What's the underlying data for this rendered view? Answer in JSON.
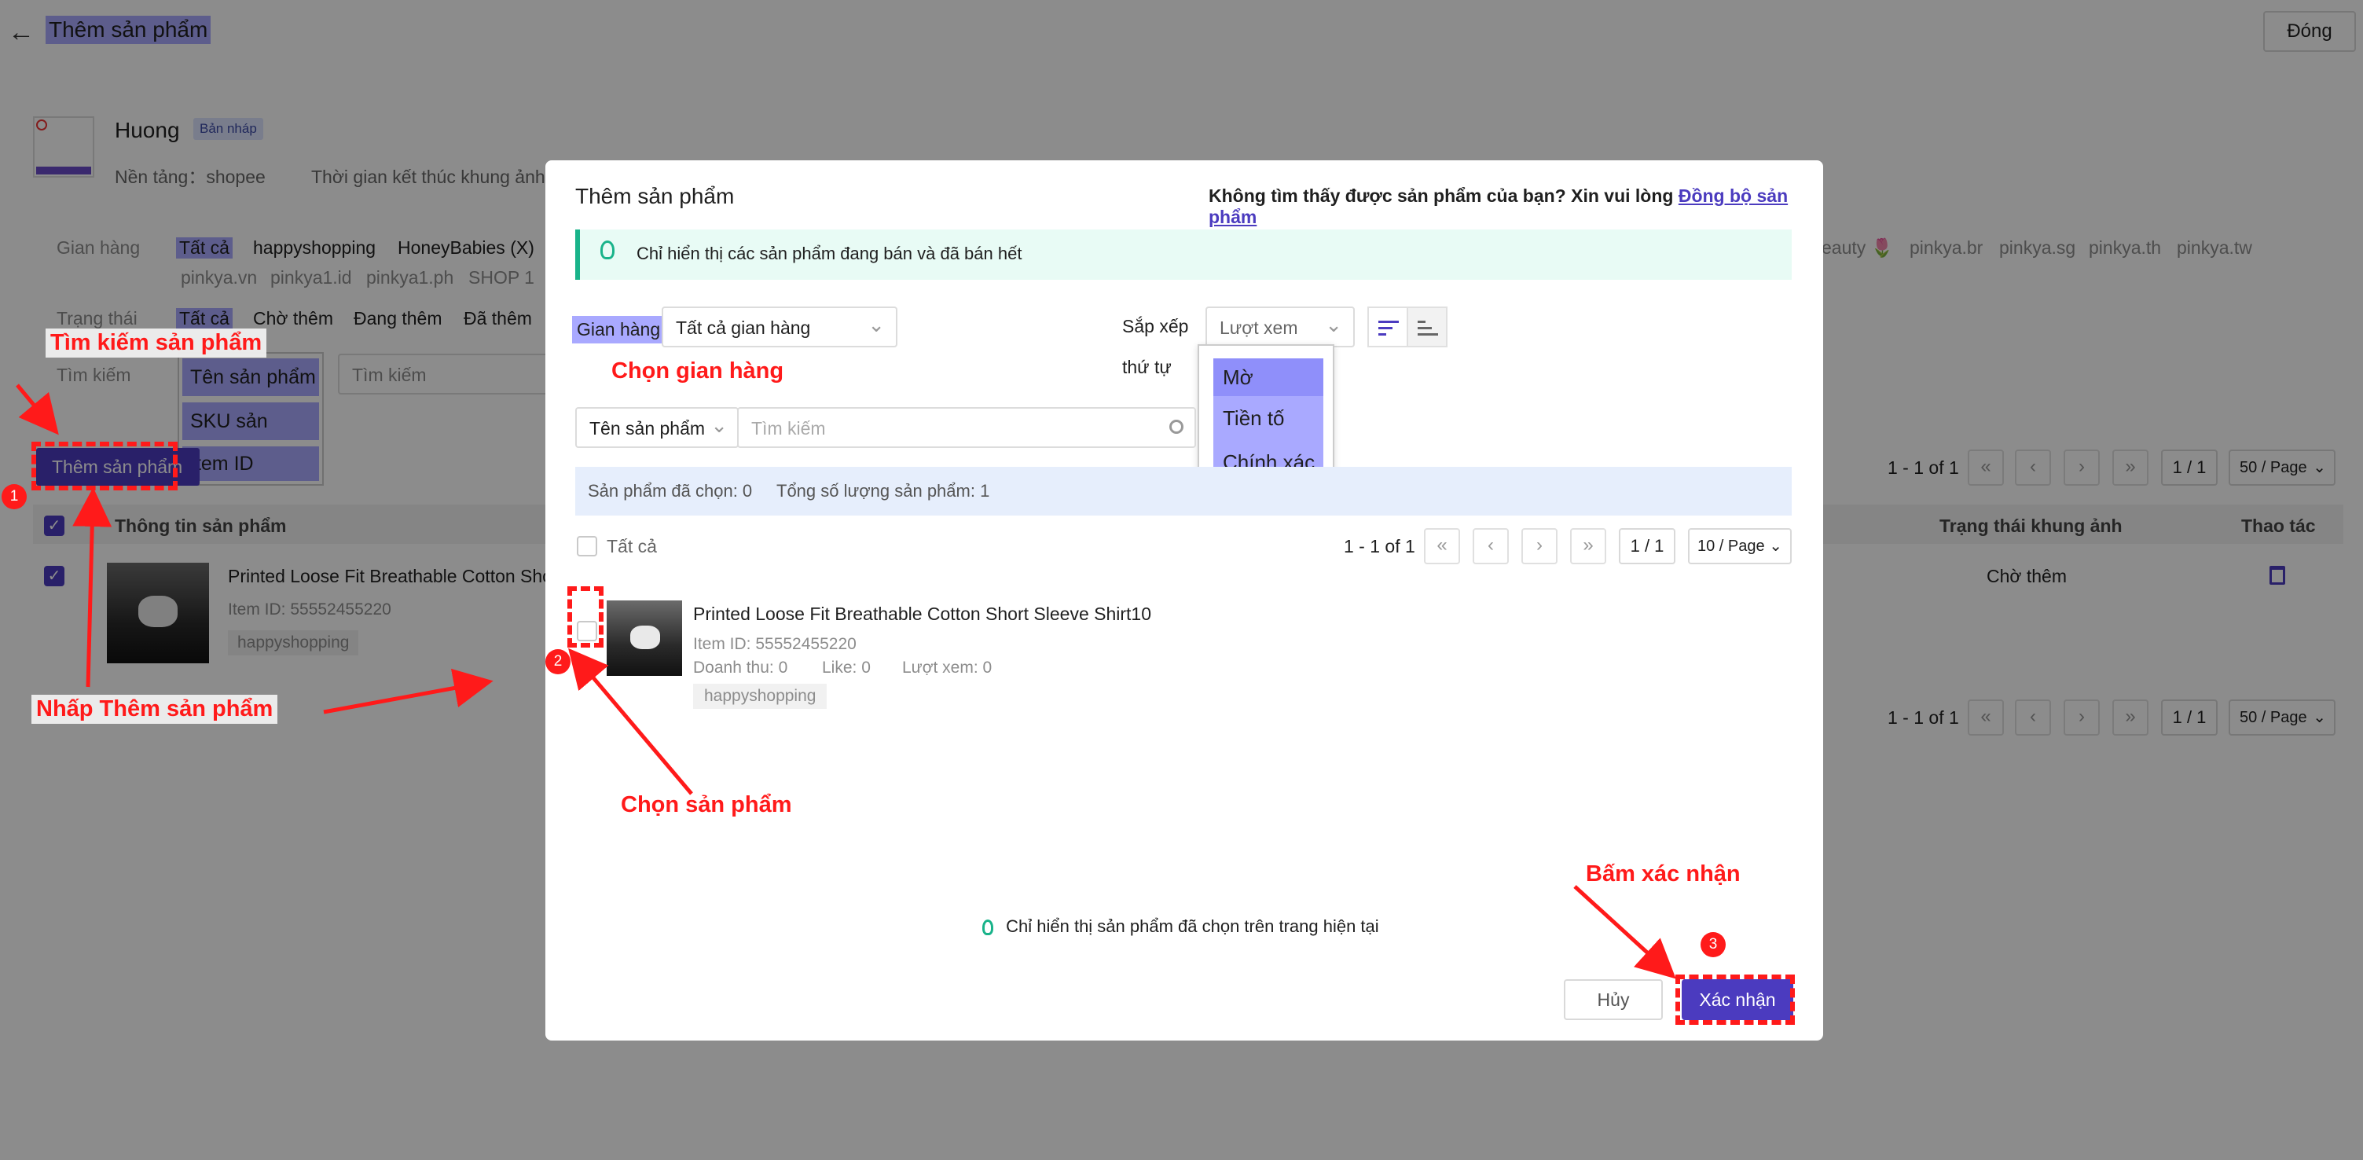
{
  "header": {
    "title": "Thêm sản phẩm",
    "close_label": "Đóng"
  },
  "campaign": {
    "name": "Huong",
    "status_badge": "Bản nháp",
    "platform": "Nền tảng：shopee",
    "end_time_label": "Thời gian kết thúc khung ảnh："
  },
  "filters": {
    "store_label": "Gian hàng",
    "stores_row1": [
      "Tất cả",
      "happyshopping",
      "HoneyBabies (X)"
    ],
    "stores_row2": [
      "pinkya.vn",
      "pinkya1.id",
      "pinkya1.ph",
      "SHOP 1"
    ],
    "stores_right": [
      "eauty 🌷",
      "pinkya.br",
      "pinkya.sg",
      "pinkya.th",
      "pinkya.tw"
    ],
    "status_label": "Trạng thái",
    "statuses": [
      "Tất cả",
      "Chờ thêm",
      "Đang thêm",
      "Đã thêm"
    ],
    "search_label": "Tìm kiếm",
    "search_placeholder": "Tìm kiếm",
    "search_options": [
      "Tên sản phẩm",
      "SKU sản phẩm",
      "Item ID"
    ]
  },
  "background_table": {
    "add_button": "Thêm sản phẩm",
    "pagination_text": "1 - 1 of 1",
    "page_text": "1 / 1",
    "page_size": "50 / Page",
    "col_product": "Thông tin sản phẩm",
    "col_status": "Trạng thái khung ảnh",
    "col_action": "Thao tác",
    "row": {
      "name": "Printed Loose Fit Breathable Cotton Sho",
      "item_id": "Item ID: 55552455220",
      "store": "happyshopping",
      "status": "Chờ thêm"
    }
  },
  "modal": {
    "title": "Thêm sản phẩm",
    "not_found_text": "Không tìm thấy được sản phẩm của bạn? Xin vui lòng",
    "sync_link": "Đồng bộ sản phẩm",
    "info_banner": "Chỉ hiển thị các sản phẩm đang bán và đã bán hết",
    "store_label": "Gian hàng",
    "store_select": "Tất cả gian hàng",
    "sort_label": "Sắp xếp",
    "sort_select": "Lượt xem",
    "order_label": "thứ tự",
    "match_options": [
      "Mờ",
      "Tiền tố",
      "Chính xác"
    ],
    "search_field_select": "Tên sản phẩm",
    "search_placeholder": "Tìm kiếm",
    "selected_count": "Sản phẩm đã chọn: 0",
    "total_count": "Tổng số lượng sản phẩm: 1",
    "select_all": "Tất cả",
    "pagination_text": "1 - 1 of 1",
    "page_text": "1 / 1",
    "page_size": "10 / Page",
    "product": {
      "name": "Printed Loose Fit Breathable Cotton Short Sleeve Shirt10",
      "item_id": "Item ID: 55552455220",
      "revenue": "Doanh thu: 0",
      "likes": "Like: 0",
      "views": "Lượt xem: 0",
      "store": "happyshopping"
    },
    "footer_hint": "Chỉ hiển thị sản phẩm đã chọn trên trang hiện tại",
    "cancel_label": "Hủy",
    "confirm_label": "Xác nhận"
  },
  "annotations": {
    "search_product": "Tìm kiếm sản phẩm",
    "click_add": "Nhấp Thêm sản phẩm",
    "choose_store": "Chọn gian hàng",
    "choose_product": "Chọn sản phẩm",
    "press_confirm": "Bấm xác nhận",
    "step1": "1",
    "step2": "2",
    "step3": "3"
  },
  "colors": {
    "accent": "#4b3bbf",
    "highlight": "#a9a9ff",
    "annotation": "#ff1a1a",
    "banner": "#e8fbf5"
  }
}
